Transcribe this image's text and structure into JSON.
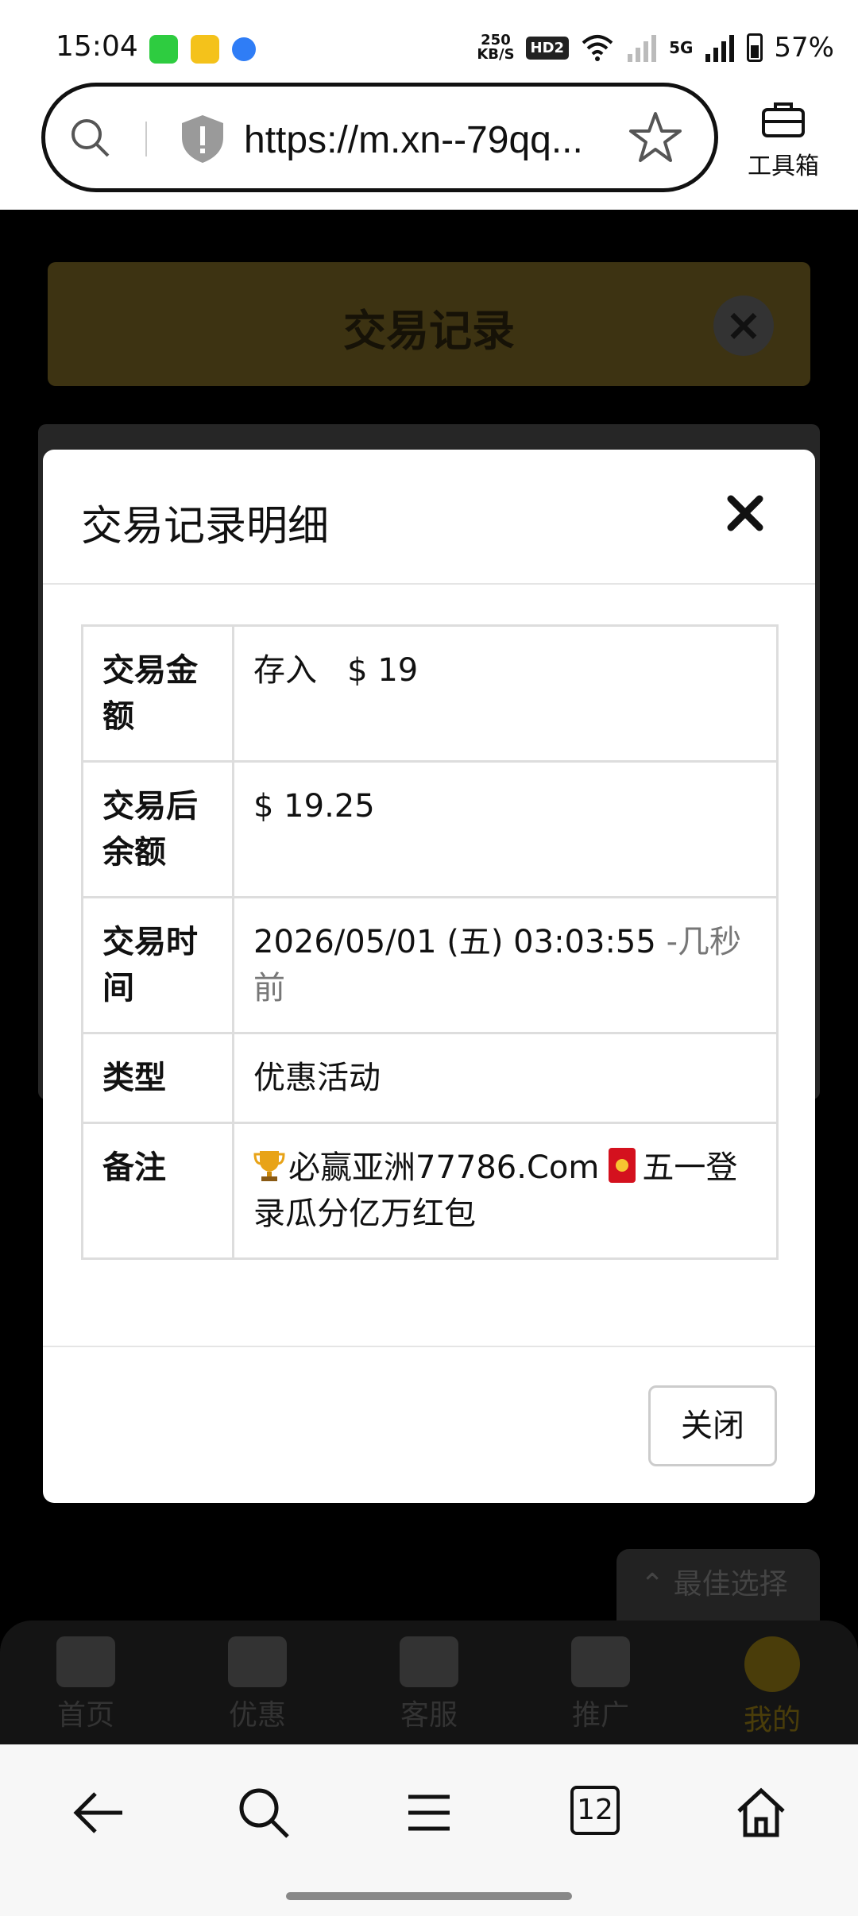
{
  "status_bar": {
    "time": "15:04",
    "net_rate_value": "250",
    "net_rate_unit": "KB/S",
    "hd_label": "HD2",
    "signal_label": "5G",
    "battery": "57%"
  },
  "browser": {
    "url": "https://m.xn--79qq...",
    "toolbox_label": "工具箱",
    "tabs_count": "12"
  },
  "background_page": {
    "header_title": "交易记录",
    "best_choice": "最佳选择",
    "nav": [
      {
        "label": "首页",
        "icon": "home-icon"
      },
      {
        "label": "优惠",
        "icon": "gift-icon"
      },
      {
        "label": "客服",
        "icon": "headset-icon"
      },
      {
        "label": "推广",
        "icon": "add-user-icon"
      },
      {
        "label": "我的",
        "icon": "user-icon"
      }
    ]
  },
  "modal": {
    "title": "交易记录明细",
    "close_button": "关闭",
    "rows": {
      "amount": {
        "label": "交易金额",
        "type_text": "存入",
        "value": "$ 19"
      },
      "balance": {
        "label": "交易后余额",
        "value": "$ 19.25"
      },
      "time": {
        "label": "交易时间",
        "value": "2026/05/01 (五) 03:03:55",
        "relative": "-几秒前"
      },
      "category": {
        "label": "类型",
        "value": "优惠活动"
      },
      "note": {
        "label": "备注",
        "part1": "必赢亚洲77786.Com",
        "part2": "五一登录瓜分亿万红包"
      }
    }
  },
  "colors": {
    "deposit_green": "#3a7d3a",
    "brand_gold": "#c9a227"
  }
}
